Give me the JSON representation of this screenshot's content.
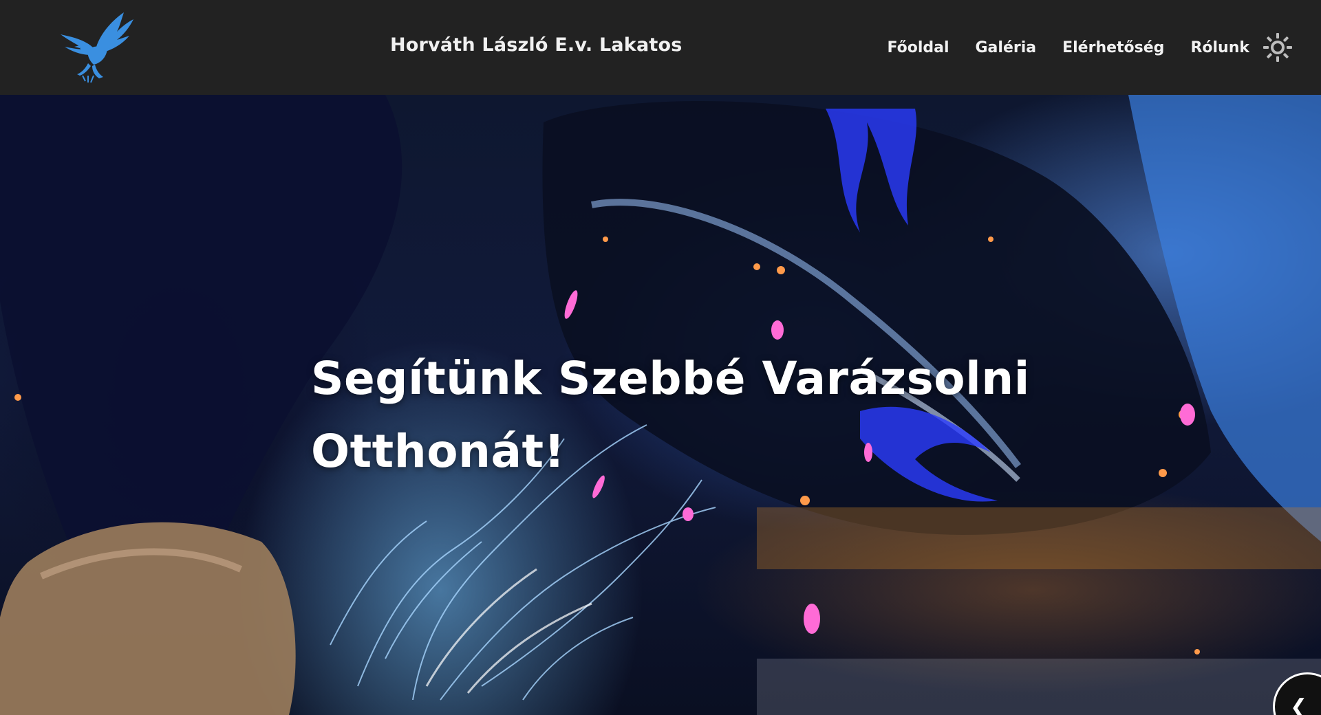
{
  "header": {
    "logo_icon": "eagle-logo-icon",
    "site_title": "Horváth László E.v. Lakatos",
    "nav": [
      {
        "label": "Főoldal"
      },
      {
        "label": "Galéria"
      },
      {
        "label": "Elérhetőség"
      },
      {
        "label": "Rólunk"
      }
    ],
    "theme_toggle_icon": "sun-icon"
  },
  "hero": {
    "title": "Segítünk Szebbé Varázsolni Otthonát!",
    "background_icon": "welding-photo",
    "corner_icon": "chevron-left-icon"
  },
  "colors": {
    "header_bg": "#222222",
    "logo_blue": "#3a8fe0",
    "text": "#ffffff",
    "icon_gray": "#bdbdbd"
  }
}
